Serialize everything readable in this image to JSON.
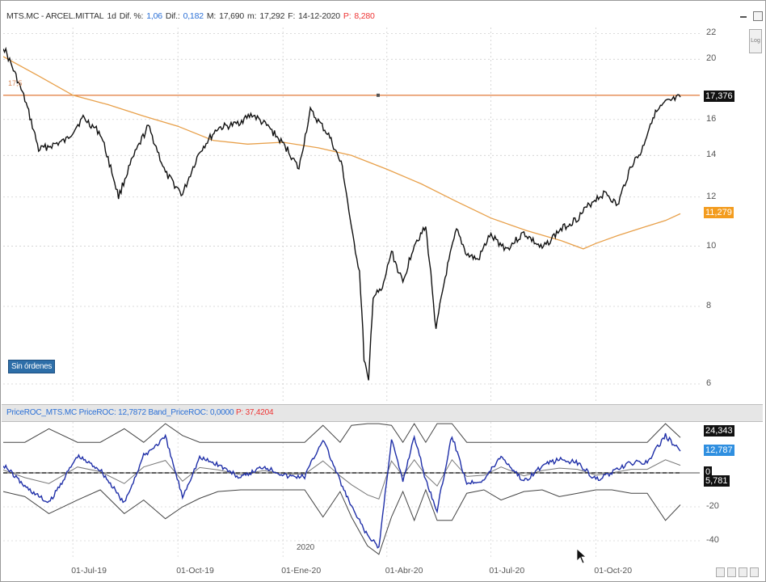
{
  "header": {
    "symbol": "MTS.MC - ARCEL.MITTAL",
    "interval": "1d",
    "dif_pct_label": "Dif. %:",
    "dif_pct": "1,06",
    "dif_label": "Dif.:",
    "dif": "0,182",
    "max_label": "M:",
    "max": "17,690",
    "min_label": "m:",
    "min": "17,292",
    "date_label": "F:",
    "date": "14-12-2020",
    "p_label": "P:",
    "p": "8,280"
  },
  "controls": {
    "log_label": "Log",
    "orders_label": "Sin órdenes"
  },
  "price_panel": {
    "reference_label": "17,5",
    "last_price_badge": "17,376",
    "ma_badge": "11,279"
  },
  "roc_panel": {
    "title": "PriceROC_MTS.MC PriceROC: 12,7872 Band_PriceROC: 0,0000",
    "p_value": "P: 37,4204",
    "badge_upper": "24,343",
    "badge_value": "12,787",
    "badge_zero": "0",
    "badge_lower": "5,781"
  },
  "x_axis": {
    "year_label": "2020",
    "ticks": [
      "01-Jul-19",
      "01-Oct-19",
      "01-Ene-20",
      "01-Abr-20",
      "01-Jul-20",
      "01-Oct-20"
    ]
  },
  "colors": {
    "price": "#111111",
    "moving_average": "#e8a04a",
    "reference_line": "#e07a38",
    "roc_line": "#1f2fa8",
    "band_line": "#444444",
    "ma_badge": "#f39c1f",
    "price_badge": "#111111",
    "roc_badge": "#2f8fe0"
  },
  "chart_data": [
    {
      "type": "line",
      "scale": "log",
      "ylim": [
        5.6,
        22.5
      ],
      "yticks": [
        6,
        8,
        10,
        12,
        14,
        16,
        20,
        22
      ],
      "x_range": [
        "2019-05-01",
        "2020-12-31"
      ],
      "reference_level": 17.5,
      "grid": true,
      "series": [
        {
          "role": "price",
          "x": [
            "2019-05-01",
            "2019-05-20",
            "2019-06-01",
            "2019-06-25",
            "2019-07-10",
            "2019-07-25",
            "2019-08-10",
            "2019-08-20",
            "2019-09-05",
            "2019-09-20",
            "2019-10-05",
            "2019-10-20",
            "2019-11-05",
            "2019-11-20",
            "2019-12-05",
            "2019-12-20",
            "2020-01-05",
            "2020-01-15",
            "2020-01-25",
            "2020-02-10",
            "2020-02-22",
            "2020-03-01",
            "2020-03-08",
            "2020-03-12",
            "2020-03-16",
            "2020-03-20",
            "2020-03-28",
            "2020-04-05",
            "2020-04-15",
            "2020-04-25",
            "2020-05-05",
            "2020-05-14",
            "2020-05-22",
            "2020-06-01",
            "2020-06-10",
            "2020-06-20",
            "2020-06-30",
            "2020-07-15",
            "2020-07-30",
            "2020-08-15",
            "2020-08-30",
            "2020-09-15",
            "2020-09-30",
            "2020-10-10",
            "2020-10-20",
            "2020-11-01",
            "2020-11-10",
            "2020-11-20",
            "2020-12-01",
            "2020-12-14"
          ],
          "y": [
            21.0,
            17.2,
            14.3,
            14.8,
            16.1,
            15.2,
            12.0,
            13.5,
            15.6,
            13.1,
            12.1,
            14.2,
            15.5,
            15.7,
            16.3,
            15.5,
            14.3,
            13.3,
            16.5,
            15.1,
            13.4,
            10.6,
            9.1,
            6.6,
            6.0,
            8.3,
            8.5,
            9.8,
            8.7,
            10.1,
            10.7,
            7.3,
            8.9,
            10.6,
            9.7,
            9.5,
            10.4,
            9.9,
            10.5,
            9.9,
            10.6,
            11.1,
            11.9,
            12.2,
            11.6,
            13.5,
            14.2,
            16.2,
            17.0,
            17.38
          ]
        },
        {
          "role": "moving-average",
          "x": [
            "2019-05-01",
            "2019-06-01",
            "2019-07-01",
            "2019-08-01",
            "2019-09-01",
            "2019-10-01",
            "2019-11-01",
            "2019-12-01",
            "2020-01-01",
            "2020-02-01",
            "2020-03-01",
            "2020-04-01",
            "2020-05-01",
            "2020-06-01",
            "2020-07-01",
            "2020-08-01",
            "2020-09-01",
            "2020-09-20",
            "2020-10-01",
            "2020-10-20",
            "2020-11-10",
            "2020-12-01",
            "2020-12-14"
          ],
          "y": [
            20.2,
            18.8,
            17.5,
            16.9,
            16.2,
            15.6,
            14.8,
            14.6,
            14.7,
            14.4,
            14.0,
            13.3,
            12.6,
            11.8,
            11.1,
            10.6,
            10.2,
            9.9,
            10.1,
            10.4,
            10.7,
            11.0,
            11.28
          ]
        }
      ]
    },
    {
      "type": "line",
      "title": "PriceROC",
      "ylim": [
        -50,
        30
      ],
      "yticks": [
        0,
        -20,
        -40
      ],
      "x_range": [
        "2019-05-01",
        "2020-12-31"
      ],
      "series": [
        {
          "name": "PriceROC",
          "x": [
            "2019-05-01",
            "2019-05-20",
            "2019-06-10",
            "2019-07-05",
            "2019-07-25",
            "2019-08-15",
            "2019-09-01",
            "2019-09-20",
            "2019-10-05",
            "2019-10-20",
            "2019-11-05",
            "2019-11-25",
            "2019-12-15",
            "2020-01-05",
            "2020-01-20",
            "2020-02-05",
            "2020-02-20",
            "2020-03-01",
            "2020-03-15",
            "2020-03-25",
            "2020-04-05",
            "2020-04-15",
            "2020-04-25",
            "2020-05-05",
            "2020-05-15",
            "2020-05-28",
            "2020-06-10",
            "2020-06-25",
            "2020-07-10",
            "2020-07-30",
            "2020-08-15",
            "2020-08-30",
            "2020-09-15",
            "2020-10-01",
            "2020-10-15",
            "2020-11-01",
            "2020-11-15",
            "2020-12-01",
            "2020-12-14"
          ],
          "y": [
            5,
            -8,
            -18,
            10,
            2,
            -18,
            10,
            21,
            -14,
            9,
            5,
            -3,
            4,
            -2,
            -2,
            20,
            -5,
            -20,
            -37,
            -44,
            20,
            -5,
            22,
            -4,
            -22,
            22,
            -6,
            -4,
            10,
            -5,
            4,
            8,
            6,
            -4,
            0,
            6,
            6,
            22,
            12.79
          ]
        },
        {
          "name": "Band_PriceROC",
          "x": [
            "2019-05-01",
            "2019-08-01",
            "2019-10-01",
            "2020-01-01",
            "2020-02-15",
            "2020-03-15",
            "2020-04-01",
            "2020-05-01",
            "2020-06-01",
            "2020-07-01",
            "2020-09-01",
            "2020-10-01",
            "2020-12-14"
          ],
          "y": [
            0,
            0,
            0,
            0,
            0,
            0,
            0,
            0,
            0,
            0,
            0,
            0,
            0
          ]
        }
      ]
    }
  ]
}
